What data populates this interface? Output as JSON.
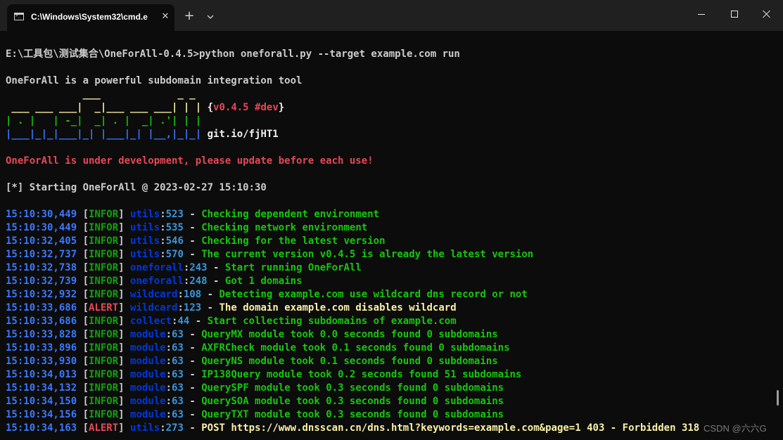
{
  "window": {
    "tab_title": "C:\\Windows\\System32\\cmd.e",
    "close_tab_glyph": "✕",
    "new_tab_glyph": "+"
  },
  "console": {
    "prompt": "E:\\工具包\\测试集合\\OneForAll-0.4.5>python oneforall.py --target example.com run",
    "intro": "OneForAll is a powerful subdomain integration tool",
    "banner": {
      "row1": "             ___             _ _",
      "row2": " ___ ___ ___|  _|___ ___ ___| | |",
      "row3": "| . |   | -_|  _| . |  _| .'| | |",
      "row4": "|___|_|_|___|_| |___|_| |__,|_|_|",
      "version_open": "{",
      "version": "v0.4.5 #dev",
      "version_close": "}",
      "link": "git.io/fjHT1"
    },
    "warning": "OneForAll is under development, please update before each use!",
    "start": "[*] Starting OneForAll @ 2023-02-27 15:10:30",
    "logs": [
      {
        "time": "15:10:30,449",
        "level": "INFOR",
        "module": "utils",
        "line": "523",
        "msg": "Checking dependent environment"
      },
      {
        "time": "15:10:30,449",
        "level": "INFOR",
        "module": "utils",
        "line": "535",
        "msg": "Checking network environment"
      },
      {
        "time": "15:10:32,405",
        "level": "INFOR",
        "module": "utils",
        "line": "546",
        "msg": "Checking for the latest version"
      },
      {
        "time": "15:10:32,737",
        "level": "INFOR",
        "module": "utils",
        "line": "570",
        "msg": "The current version v0.4.5 is already the latest version"
      },
      {
        "time": "15:10:32,738",
        "level": "INFOR",
        "module": "oneforall",
        "line": "243",
        "msg": "Start running OneForAll"
      },
      {
        "time": "15:10:32,739",
        "level": "INFOR",
        "module": "oneforall",
        "line": "248",
        "msg": "Got 1 domains"
      },
      {
        "time": "15:10:32,932",
        "level": "INFOR",
        "module": "wildcard",
        "line": "108",
        "msg": "Detecting example.com use wildcard dns record or not"
      },
      {
        "time": "15:10:33,686",
        "level": "ALERT",
        "module": "wildcard",
        "line": "123",
        "msg": "The domain example.com disables wildcard"
      },
      {
        "time": "15:10:33,686",
        "level": "INFOR",
        "module": "collect",
        "line": "44",
        "msg": "Start collecting subdomains of example.com"
      },
      {
        "time": "15:10:33,828",
        "level": "INFOR",
        "module": "module",
        "line": "63",
        "msg": "QueryMX module took 0.0 seconds found 0 subdomains"
      },
      {
        "time": "15:10:33,896",
        "level": "INFOR",
        "module": "module",
        "line": "63",
        "msg": "AXFRCheck module took 0.1 seconds found 0 subdomains"
      },
      {
        "time": "15:10:33,930",
        "level": "INFOR",
        "module": "module",
        "line": "63",
        "msg": "QueryNS module took 0.1 seconds found 0 subdomains"
      },
      {
        "time": "15:10:34,013",
        "level": "INFOR",
        "module": "module",
        "line": "63",
        "msg": "IP138Query module took 0.2 seconds found 51 subdomains"
      },
      {
        "time": "15:10:34,132",
        "level": "INFOR",
        "module": "module",
        "line": "63",
        "msg": "QuerySPF module took 0.3 seconds found 0 subdomains"
      },
      {
        "time": "15:10:34,150",
        "level": "INFOR",
        "module": "module",
        "line": "63",
        "msg": "QuerySOA module took 0.3 seconds found 0 subdomains"
      },
      {
        "time": "15:10:34,156",
        "level": "INFOR",
        "module": "module",
        "line": "63",
        "msg": "QueryTXT module took 0.3 seconds found 0 subdomains"
      },
      {
        "time": "15:10:34,163",
        "level": "ALERT",
        "module": "utils",
        "line": "273",
        "msg": "POST https://www.dnsscan.cn/dns.html?keywords=example.com&page=1 403 - Forbidden 318"
      }
    ]
  },
  "watermark": "CSDN @六六G",
  "colors": {
    "time": "#3b78ff",
    "bracket": "#cccccc",
    "INFOR": "#13a10e",
    "ALERT": "#e74856",
    "module": "#0037da",
    "line": "#3a96dd",
    "INFOR_msg": "#16c60c",
    "ALERT_msg": "#f9f1a5",
    "warning": "#e74856"
  }
}
